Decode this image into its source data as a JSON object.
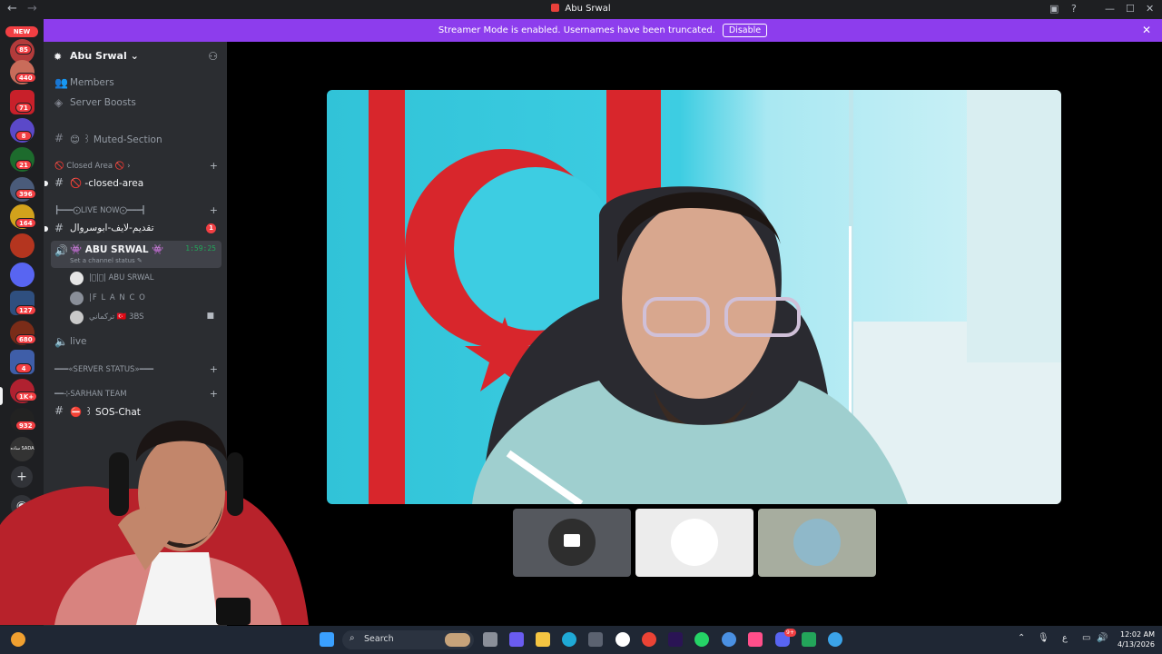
{
  "window": {
    "title": "Abu Srwal",
    "back_glyph": "←",
    "forward_glyph": "→"
  },
  "banner": {
    "message": "Streamer Mode is enabled. Usernames have been truncated.",
    "disable_label": "Disable"
  },
  "rail": {
    "new_label": "NEW",
    "badges": [
      "85",
      "440",
      "71",
      "8",
      "21",
      "396",
      "164",
      "127",
      "680",
      "4",
      "1K+",
      "932"
    ],
    "sada_label": "ساده SADA"
  },
  "guild": {
    "name": "Abu Srwal"
  },
  "sidebar": {
    "members": "Members",
    "server_boosts": "Server Boosts",
    "muted_section": "꒱ Muted-Section",
    "closed_area_category": "Closed Area",
    "closed_area_channel": "-closed-area",
    "live_now_category": "┣━━━⨀LIVE NOW⨀━━━┫",
    "arabic_channel": "تقديم-لايف-ابوسروال",
    "arabic_channel_badge": "1",
    "voice_channel": "ABU SRWAL",
    "voice_timer": "1:59:25",
    "voice_status": "Set a channel status",
    "voice_users": [
      "|️⃣|️⃣| ABU SRWAL",
      "|F L A N C O",
      "تركماني 🇹🇷 3BS"
    ],
    "live_channel": "live",
    "server_status_category": "━━━«SERVER STATUS»━━━",
    "sarhan_category": "━━⊹SARHAN TEAM",
    "sos_channel": "꒱ SOS-Chat"
  },
  "taskbar": {
    "search_placeholder": "Search",
    "language": "ع",
    "time": "12:02 AM",
    "date": "4/13/2026",
    "discord_badge": "9+"
  },
  "colors": {
    "accent": "#8d3ded",
    "badge": "#f23f43",
    "sidebar": "#2b2d31",
    "rail": "#1e1f22"
  }
}
